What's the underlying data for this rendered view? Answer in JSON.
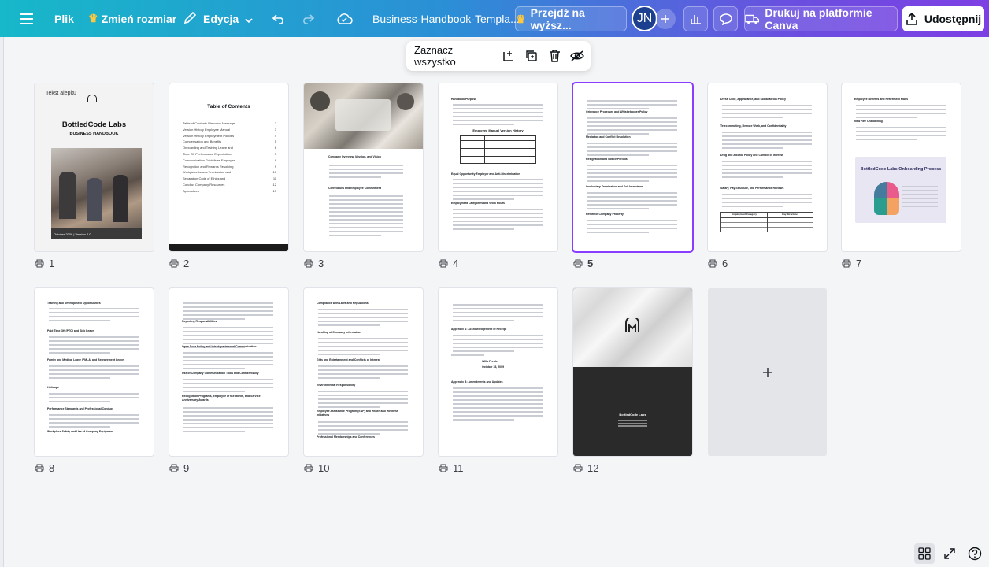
{
  "topbar": {
    "file_label": "Plik",
    "resize_label": "Zmień rozmiar",
    "edit_label": "Edycja",
    "doc_title": "Business-Handbook-Templa...",
    "upgrade_label": "Przejdź na wyższ...",
    "avatar_initials": "JN",
    "print_label": "Drukuj na platformie Canva",
    "share_label": "Udostępnij"
  },
  "selection_toolbar": {
    "select_all_label": "Zaznacz wszystko"
  },
  "pages": [
    {
      "number": "1",
      "alt_text_label": "Tekst alepitu",
      "title": "BottledCode Labs",
      "subtitle": "BUSINESS HANDBOOK",
      "footer": "October 2009 | Version 2.0"
    },
    {
      "number": "2",
      "title": "Table of Contents",
      "toc": [
        "Table of Contents Welcome Message",
        "Version History Employee Manual",
        "Version History Employment Policies",
        "Compensation and Benefits",
        "Onboarding and Training Leave and",
        "Time Off Performance Expectations",
        "Communication Guidelines Employee",
        "Recognition and Rewards Resolving",
        "Workplace Issues Termination and",
        "Separation Code of Ethics and",
        "Conduct Company Resources",
        "Appendices"
      ],
      "toc_pages": [
        "2",
        "3",
        "4",
        "5",
        "6",
        "7",
        "8",
        "9",
        "10",
        "11",
        "12",
        "13"
      ]
    },
    {
      "number": "3",
      "heading1": "Company Overview, Mission, and Vision",
      "heading2": "Core Values and Employee Commitment"
    },
    {
      "number": "4",
      "heading1": "Handbook Purpose",
      "table_title": "Employee Manual Version History",
      "heading2": "Equal Opportunity Employer and Anti-Discrimination",
      "heading3": "Employment Categories and Work Hours"
    },
    {
      "number": "5",
      "heading1": "Grievance Procedure and Whistleblower Policy",
      "heading2": "Mediation and Conflict Resolution",
      "heading3": "Resignation and Notice Periods",
      "heading4": "Involuntary Termination and Exit Interviews",
      "heading5": "Return of Company Property"
    },
    {
      "number": "6",
      "heading1": "Dress Code, Appearance, and Social Media Policy",
      "heading2": "Telecommuting, Remote Work, and Confidentiality",
      "heading3": "Drug and Alcohol Policy and Conflict of Interest",
      "heading4": "Salary, Pay Structure, and Performance Reviews",
      "table_col1": "Employment Category",
      "table_col2": "Pay Structure"
    },
    {
      "number": "7",
      "heading1": "Employee Benefits and Retirement Plans",
      "heading2": "New Hire Onboarding",
      "graphic_title": "BottledCode Labs Onboarding Process"
    },
    {
      "number": "8",
      "heading1": "Training and Development Opportunities",
      "heading2": "Paid Time Off (PTO) and Sick Leave",
      "heading3": "Family and Medical Leave (FMLA) and Bereavement Leave",
      "heading4": "Holidays",
      "heading5": "Performance Standards and Professional Conduct",
      "heading6": "Workplace Safety and Use of Company Equipment"
    },
    {
      "number": "9",
      "heading1": "Reporting Responsibilities",
      "heading2": "Open Door Policy and Interdepartmental Communication",
      "heading3": "Use of Company Communication Tools and Confidentiality",
      "heading4": "Recognition Programs, Employee of the Month, and Service Anniversary Awards"
    },
    {
      "number": "10",
      "heading1": "Compliance with Laws and Regulations",
      "heading2": "Handling of Company Information",
      "heading3": "Gifts and Entertainment and Conflicts of Interest",
      "heading4": "Environmental Responsibility",
      "heading5": "Employee Assistance Program (EAP) and Health and Wellness Initiatives",
      "heading6": "Professional Memberships and Conferences"
    },
    {
      "number": "11",
      "heading1": "Appendix A: Acknowledgement of Receipt",
      "name_value": "Willa Preble",
      "date_value": "October 18, 2009",
      "heading2": "Appendix B: Amendments and Updates"
    },
    {
      "number": "12",
      "footer_title": "BottledCode Labs"
    }
  ],
  "colors": {
    "accent": "#8b3dff",
    "topbar_start": "#17b8c9",
    "topbar_end": "#7d3fe3"
  }
}
